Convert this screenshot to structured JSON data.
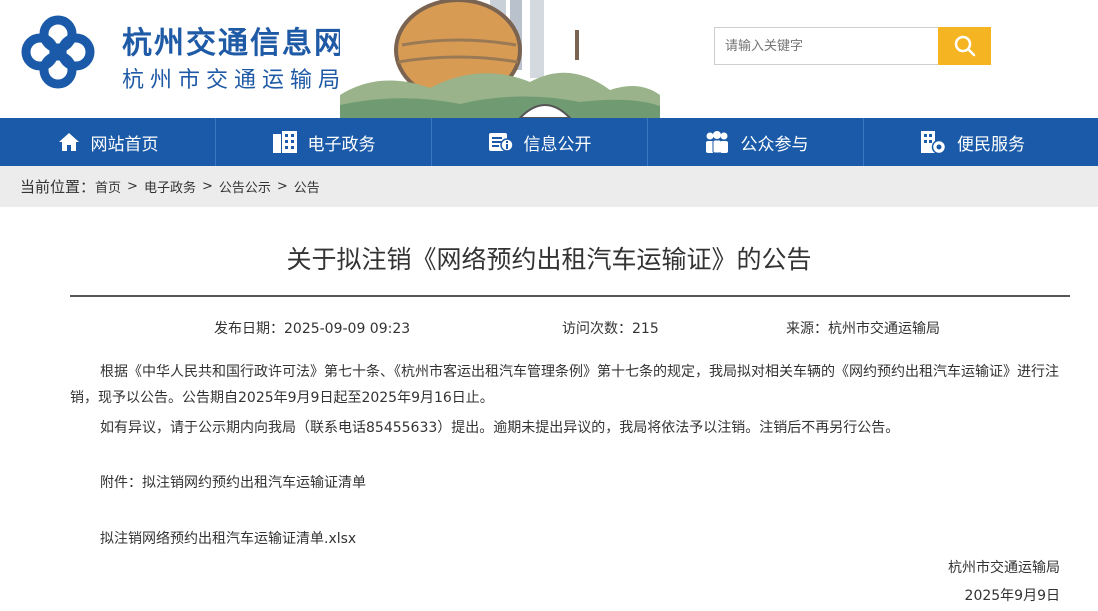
{
  "header": {
    "site_title": "杭州交通信息网",
    "site_subtitle": "杭州市交通运输局",
    "search_placeholder": "请输入关键字"
  },
  "nav": {
    "items": [
      {
        "label": "网站首页",
        "icon": "home-icon"
      },
      {
        "label": "电子政务",
        "icon": "building-icon"
      },
      {
        "label": "信息公开",
        "icon": "info-icon"
      },
      {
        "label": "公众参与",
        "icon": "people-icon"
      },
      {
        "label": "便民服务",
        "icon": "service-icon"
      }
    ]
  },
  "breadcrumb": {
    "label": "当前位置：",
    "items": [
      "首页",
      "电子政务",
      "公告公示",
      "公告"
    ],
    "separator": ">"
  },
  "article": {
    "title": "关于拟注销《网络预约出租汽车运输证》的公告",
    "publish_date": "发布日期：2025-09-09 09:23",
    "visits": "访问次数：215",
    "source": "来源：杭州市交通运输局",
    "para1": "根据《中华人民共和国行政许可法》第七十条、《杭州市客运出租汽车管理条例》第十七条的规定，我局拟对相关车辆的《网约预约出租汽车运输证》进行注销，现予以公告。公告期自2025年9月9日起至2025年9月16日止。",
    "para2": "如有异议，请于公示期内向我局（联系电话85455633）提出。逾期未提出异议的，我局将依法予以注销。注销后不再另行公告。",
    "attachment_label": "附件：拟注销网约预约出租汽车运输证清单",
    "attachment_file": "拟注销网络预约出租汽车运输证清单.xlsx",
    "signature_org": "杭州市交通运输局",
    "signature_date": "2025年9月9日"
  },
  "colors": {
    "brand_blue": "#1a5aa8",
    "search_button": "#f5b523",
    "breadcrumb_bg": "#ececec"
  }
}
